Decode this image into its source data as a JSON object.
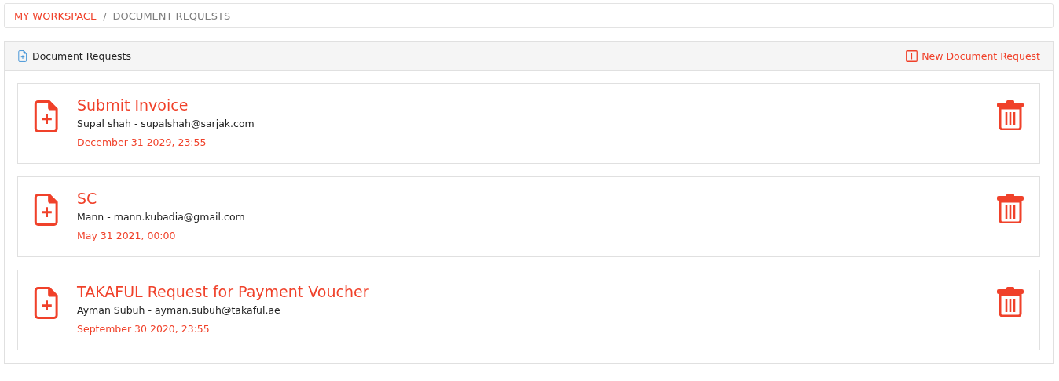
{
  "breadcrumb": [
    {
      "label": "MY WORKSPACE",
      "kind": "link"
    },
    {
      "label": "/",
      "kind": "separator"
    },
    {
      "label": "DOCUMENT REQUESTS",
      "kind": "current"
    }
  ],
  "panel": {
    "title": "Document Requests",
    "action": "New Document Request"
  },
  "requests": [
    {
      "title": "Submit Invoice",
      "contact": "Supal shah - supalshah@sarjak.com",
      "due": "December 31 2029, 23:55"
    },
    {
      "title": "SC",
      "contact": "Mann - mann.kubadia@gmail.com",
      "due": "May 31 2021, 00:00"
    },
    {
      "title": "TAKAFUL Request for Payment Voucher",
      "contact": "Ayman Subuh - ayman.subuh@takaful.ae",
      "due": "September 30 2020, 23:55"
    }
  ]
}
